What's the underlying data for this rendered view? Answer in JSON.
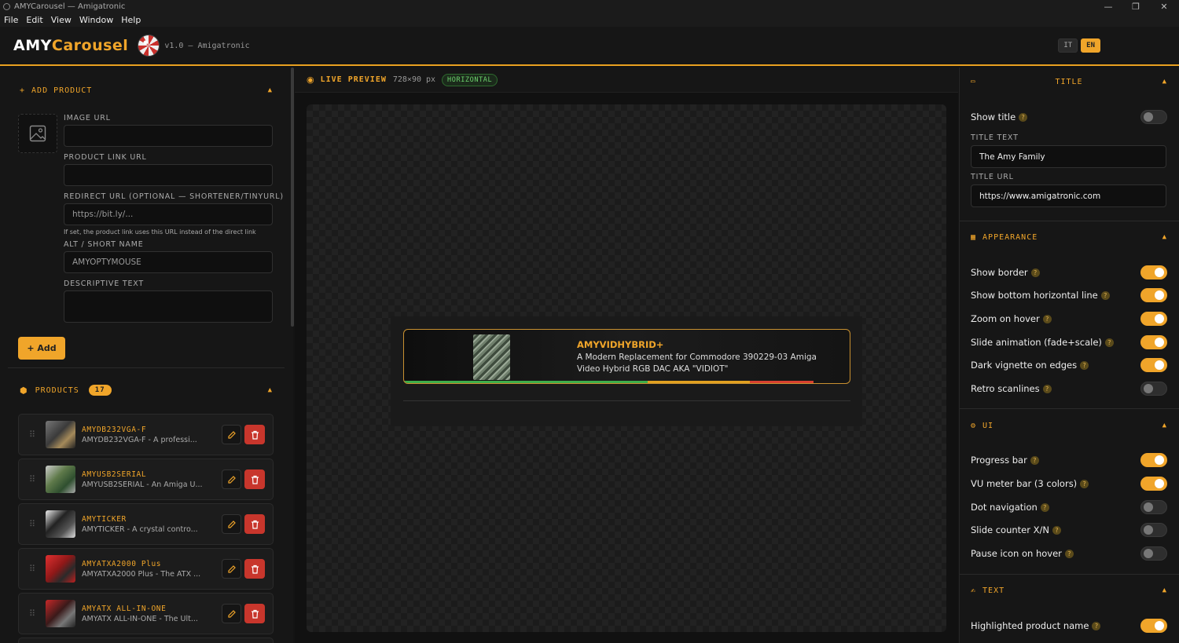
{
  "window": {
    "title": "AMYCarousel — Amigatronic",
    "controls": [
      "—",
      "❐",
      "✕"
    ]
  },
  "menu": [
    "File",
    "Edit",
    "View",
    "Window",
    "Help"
  ],
  "header": {
    "logo_part1": "AMY",
    "logo_part2": "Carousel",
    "version": "v1.0 — Amigatronic",
    "languages": [
      "IT",
      "EN"
    ],
    "active_language": "EN"
  },
  "add_product": {
    "title": "ADD PRODUCT",
    "icon": "+",
    "image_url_label": "IMAGE URL",
    "image_url_value": "",
    "product_link_label": "PRODUCT LINK URL",
    "product_link_value": "",
    "redirect_label": "REDIRECT URL (OPTIONAL — SHORTENER/TINYURL)",
    "redirect_placeholder": "https://bit.ly/...",
    "redirect_hint": "If set, the product link uses this URL instead of the direct link",
    "alt_label": "ALT / SHORT NAME",
    "alt_placeholder": "AMYOPTYMOUSE",
    "desc_label": "DESCRIPTIVE TEXT",
    "add_button": "+ Add"
  },
  "products": {
    "title": "PRODUCTS",
    "count": "17",
    "items": [
      {
        "name": "AMYDB232VGA-F",
        "desc": "AMYDB232VGA-F - A professi..."
      },
      {
        "name": "AMYUSB2SERIAL",
        "desc": "AMYUSB2SERIAL - An Amiga U..."
      },
      {
        "name": "AMYTICKER",
        "desc": "AMYTICKER - A crystal contro..."
      },
      {
        "name": "AMYATXA2000 Plus",
        "desc": "AMYATXA2000 Plus - The ATX ..."
      },
      {
        "name": "AMYATX ALL-IN-ONE",
        "desc": "AMYATX ALL-IN-ONE - The Ult..."
      }
    ]
  },
  "preview": {
    "title": "LIVE PREVIEW",
    "dimensions": "728×90 px",
    "orientation": "HORIZONTAL",
    "banner": {
      "product_name": "AMYVIDHYBRID+",
      "description": "A Modern Replacement for Commodore 390229-03 Amiga Video Hybrid RGB DAC AKA \"VIDIOT\""
    },
    "vu_colors": [
      "#3fae4a",
      "#e0a020",
      "#d84030"
    ]
  },
  "settings": {
    "title_section": {
      "title": "TITLE",
      "show_title": {
        "label": "Show title",
        "on": false
      },
      "title_text_label": "TITLE TEXT",
      "title_text_value": "The Amy Family",
      "title_url_label": "TITLE URL",
      "title_url_value": "https://www.amigatronic.com"
    },
    "appearance": {
      "title": "APPEARANCE",
      "items": [
        {
          "label": "Show border",
          "on": true
        },
        {
          "label": "Show bottom horizontal line",
          "on": true
        },
        {
          "label": "Zoom on hover",
          "on": true
        },
        {
          "label": "Slide animation (fade+scale)",
          "on": true
        },
        {
          "label": "Dark vignette on edges",
          "on": true
        },
        {
          "label": "Retro scanlines",
          "on": false
        }
      ]
    },
    "ui": {
      "title": "UI",
      "items": [
        {
          "label": "Progress bar",
          "on": true
        },
        {
          "label": "VU meter bar (3 colors)",
          "on": true
        },
        {
          "label": "Dot navigation",
          "on": false
        },
        {
          "label": "Slide counter X/N",
          "on": false
        },
        {
          "label": "Pause icon on hover",
          "on": false
        }
      ]
    },
    "text": {
      "title": "TEXT",
      "items": [
        {
          "label": "Highlighted product name",
          "on": true
        }
      ]
    }
  },
  "accent_color": "#f0a52a"
}
